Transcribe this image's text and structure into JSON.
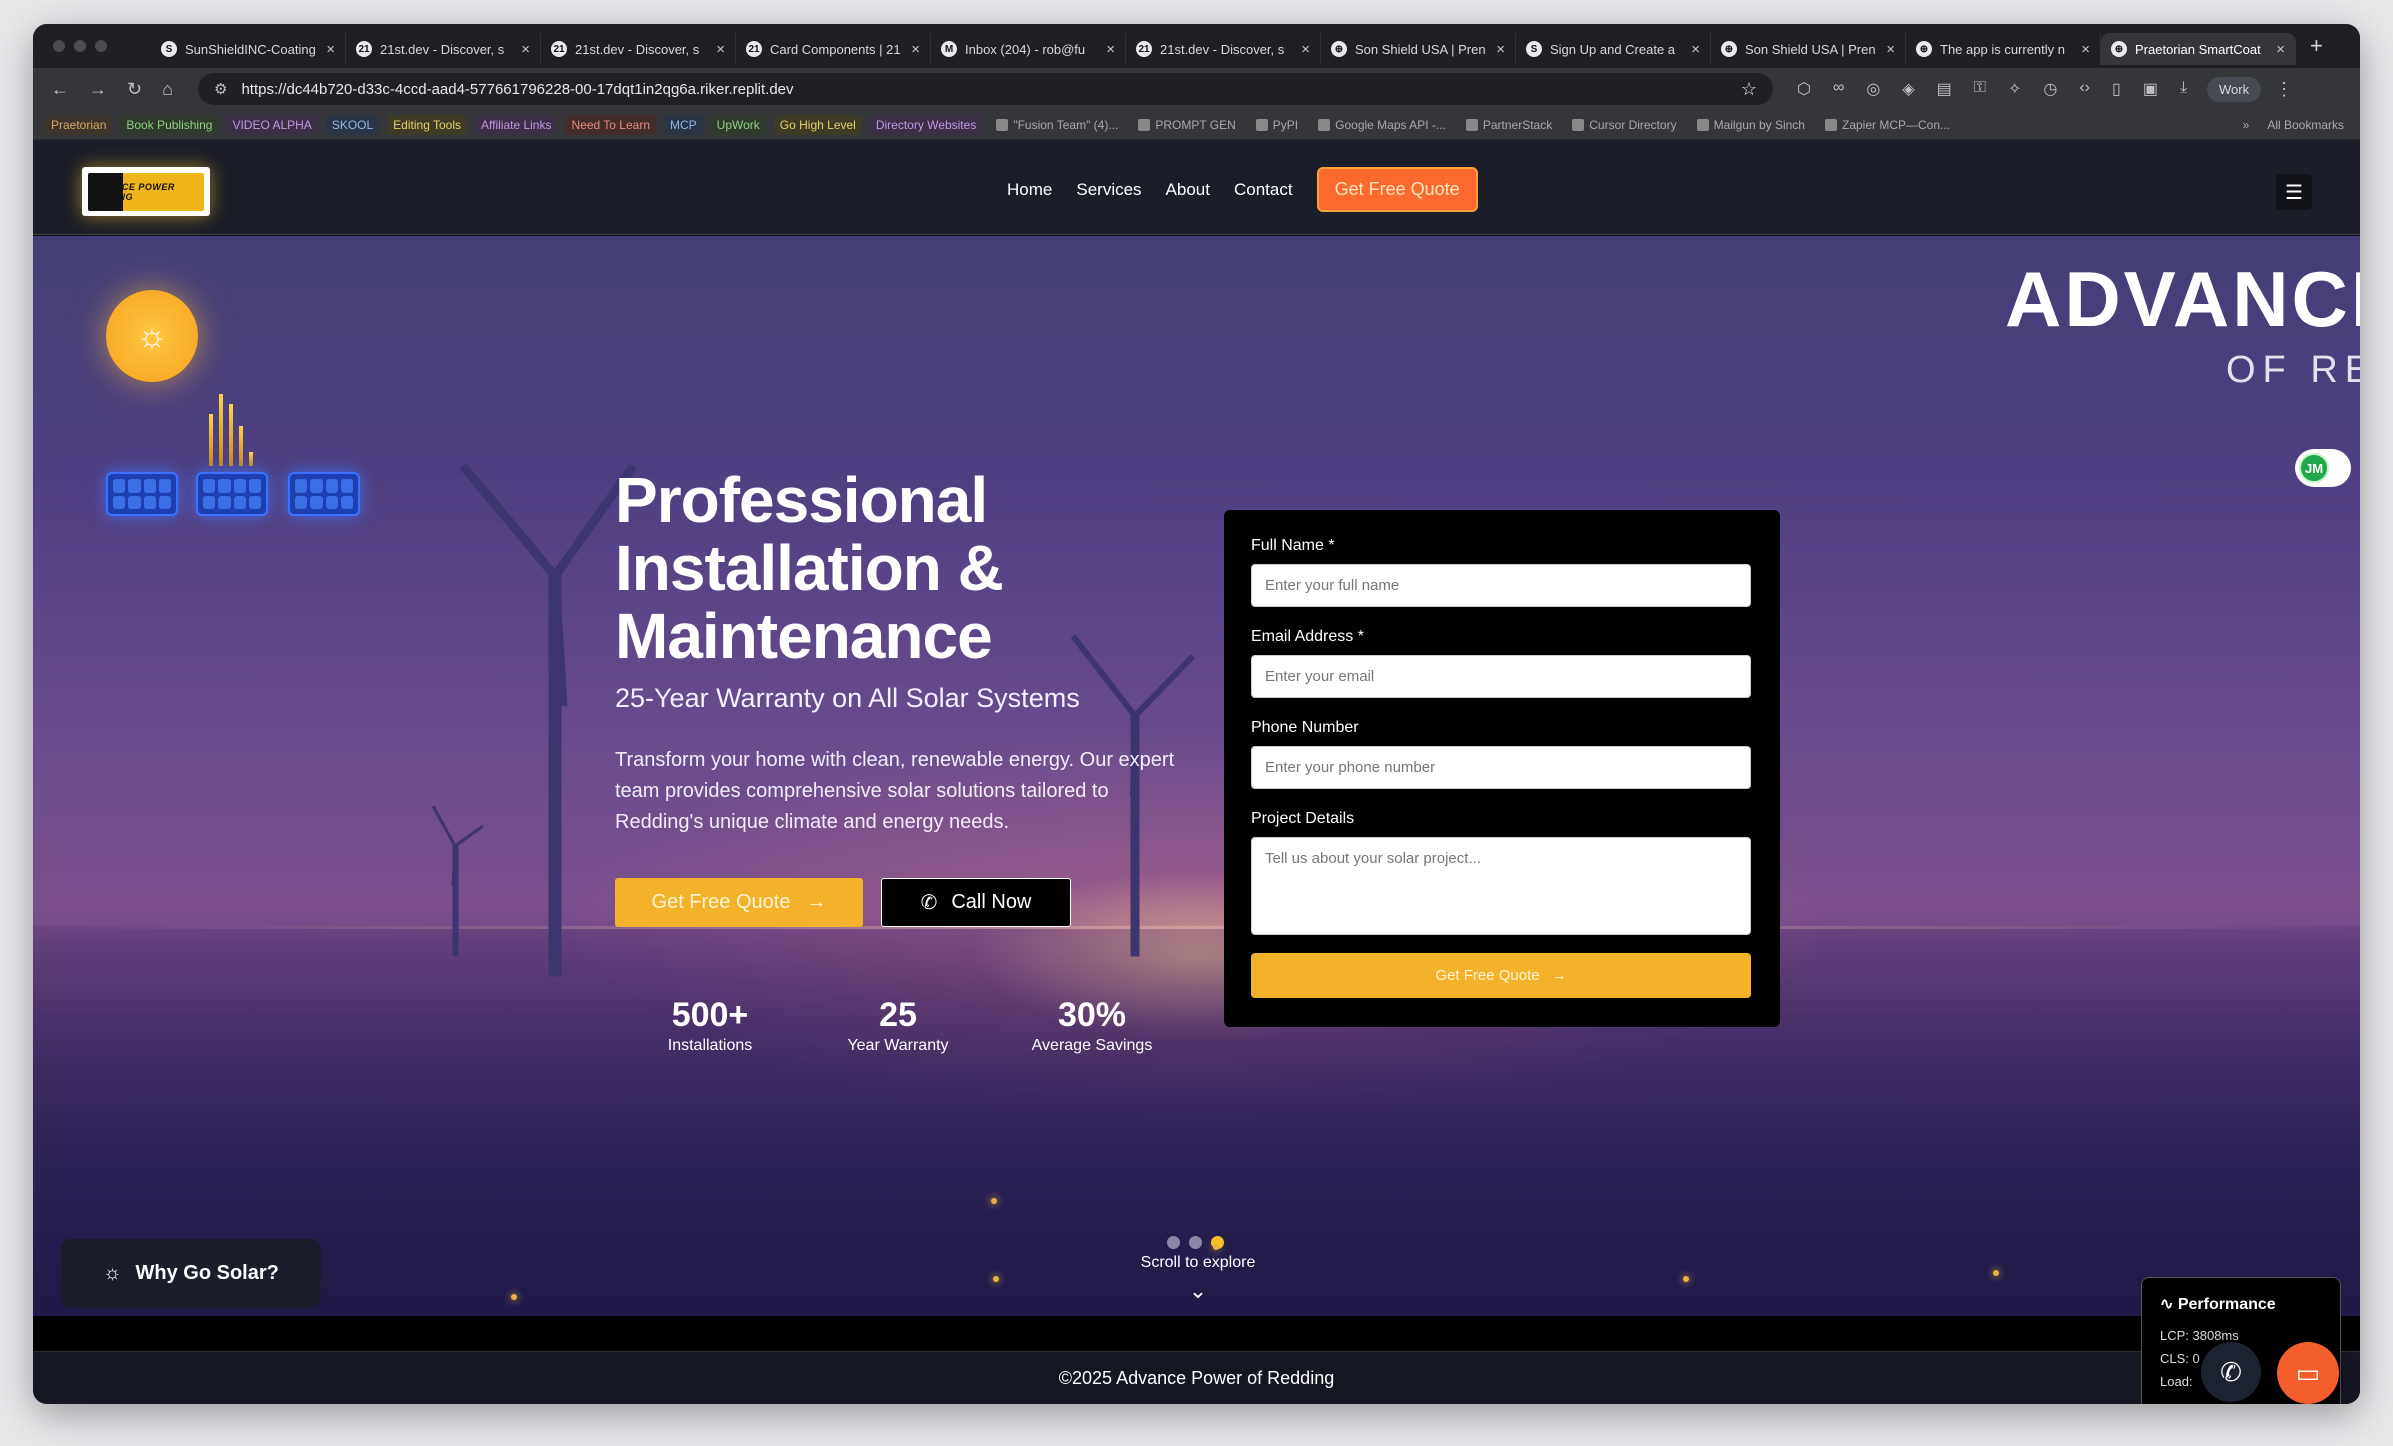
{
  "browser": {
    "tabs": [
      {
        "title": "SunShieldINC-Coating",
        "fav": "S"
      },
      {
        "title": "21st.dev - Discover, s",
        "fav": "21"
      },
      {
        "title": "21st.dev - Discover, s",
        "fav": "21"
      },
      {
        "title": "Card Components | 21",
        "fav": "21"
      },
      {
        "title": "Inbox (204) - rob@fu",
        "fav": "M"
      },
      {
        "title": "21st.dev - Discover, s",
        "fav": "21"
      },
      {
        "title": "Son Shield USA | Pren",
        "fav": "⊕"
      },
      {
        "title": "Sign Up and Create a",
        "fav": "S"
      },
      {
        "title": "Son Shield USA | Pren",
        "fav": "⊕"
      },
      {
        "title": "The app is currently n",
        "fav": "⊕"
      },
      {
        "title": "Praetorian SmartCoat",
        "fav": "⊕"
      }
    ],
    "url": "https://dc44b720-d33c-4ccd-aad4-577661796228-00-17dqt1in2qg6a.riker.replit.dev",
    "profile_label": "Work",
    "bookmarks": [
      {
        "label": "Praetorian",
        "style": "tag"
      },
      {
        "label": "Book Publishing",
        "style": "tag g"
      },
      {
        "label": "VIDEO ALPHA",
        "style": "tag p"
      },
      {
        "label": "SKOOL",
        "style": "tag b"
      },
      {
        "label": "Editing Tools",
        "style": "tag y"
      },
      {
        "label": "Affiliate Links",
        "style": "tag p"
      },
      {
        "label": "Need To Learn",
        "style": "tag r"
      },
      {
        "label": "MCP",
        "style": "tag b"
      },
      {
        "label": "UpWork",
        "style": "tag g"
      },
      {
        "label": "Go High Level",
        "style": "tag y"
      },
      {
        "label": "Directory Websites",
        "style": "tag p"
      },
      {
        "label": "\"Fusion Team\" (4)...",
        "style": "plain"
      },
      {
        "label": "PROMPT GEN",
        "style": "plain"
      },
      {
        "label": "PyPI",
        "style": "plain"
      },
      {
        "label": "Google Maps API -...",
        "style": "plain"
      },
      {
        "label": "PartnerStack",
        "style": "plain"
      },
      {
        "label": "Cursor Directory",
        "style": "plain"
      },
      {
        "label": "Mailgun by Sinch",
        "style": "plain"
      },
      {
        "label": "Zapier MCP—Con...",
        "style": "plain"
      }
    ],
    "all_bookmarks": "All Bookmarks"
  },
  "site": {
    "logo_text": "ADVANCE POWER REDDING",
    "nav": {
      "home": "Home",
      "services": "Services",
      "about": "About",
      "contact": "Contact",
      "cta": "Get Free Quote"
    },
    "brand_big": "ADVANCE",
    "brand_sub": "OF REDDING",
    "jm_badge": "JM",
    "hero": {
      "headline": "Professional Installation & Maintenance",
      "subheadline": "25-Year Warranty on All Solar Systems",
      "description": "Transform your home with clean, renewable energy. Our expert team provides comprehensive solar solutions tailored to Redding's unique climate and energy needs.",
      "quote_button": "Get Free Quote",
      "call_button": "Call Now"
    },
    "stats": [
      {
        "number": "500+",
        "label": "Installations"
      },
      {
        "number": "25",
        "label": "Year Warranty"
      },
      {
        "number": "30%",
        "label": "Average Savings"
      }
    ],
    "form": {
      "name_label": "Full Name *",
      "name_placeholder": "Enter your full name",
      "email_label": "Email Address *",
      "email_placeholder": "Enter your email",
      "phone_label": "Phone Number",
      "phone_placeholder": "Enter your phone number",
      "details_label": "Project Details",
      "details_placeholder": "Tell us about your solar project...",
      "submit": "Get Free Quote"
    },
    "scroll_hint": "Scroll to explore",
    "why_solar": "Why Go Solar?",
    "footer": "©2025 Advance Power of Redding",
    "performance": {
      "title": "Performance",
      "lcp": "LCP: 3808ms",
      "cls": "CLS: 0",
      "load": "Load:"
    }
  },
  "colors": {
    "accent_yellow": "#f3b22a",
    "accent_orange": "#fb6a2c",
    "hero_purple": "#5b3b7a"
  }
}
